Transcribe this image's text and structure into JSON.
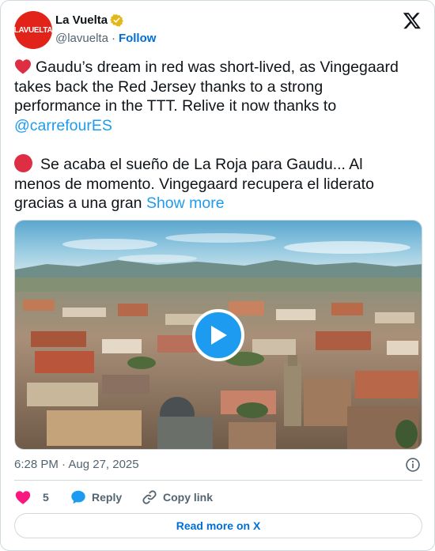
{
  "account": {
    "avatar_text": "LAVUELTA",
    "name": "La Vuelta",
    "handle": "@lavuelta",
    "separator": "·",
    "follow_label": "Follow"
  },
  "tweet": {
    "en_text": "Gaudu’s dream in red was short-lived, as Vingegaard takes back the Red Jersey thanks to a strong performance in the TTT. Relive it now thanks to",
    "mention": "@carrefourES",
    "es_text": "Se acaba el sueño de La Roja para Gaudu... Al menos de momento. Vingegaard recupera el liderato gracias a una gran",
    "show_more": "Show more"
  },
  "media": {
    "type": "video",
    "play_icon": "play-icon"
  },
  "meta": {
    "timestamp": "6:28 PM · Aug 27, 2025"
  },
  "actions": {
    "like_count": "5",
    "reply_label": "Reply",
    "copy_label": "Copy link"
  },
  "read_more_label": "Read more on X",
  "colors": {
    "accent": "#1d9bf0",
    "link": "#006fd6",
    "like": "#f91880",
    "brand_red": "#e2231a",
    "muted": "#536471"
  }
}
